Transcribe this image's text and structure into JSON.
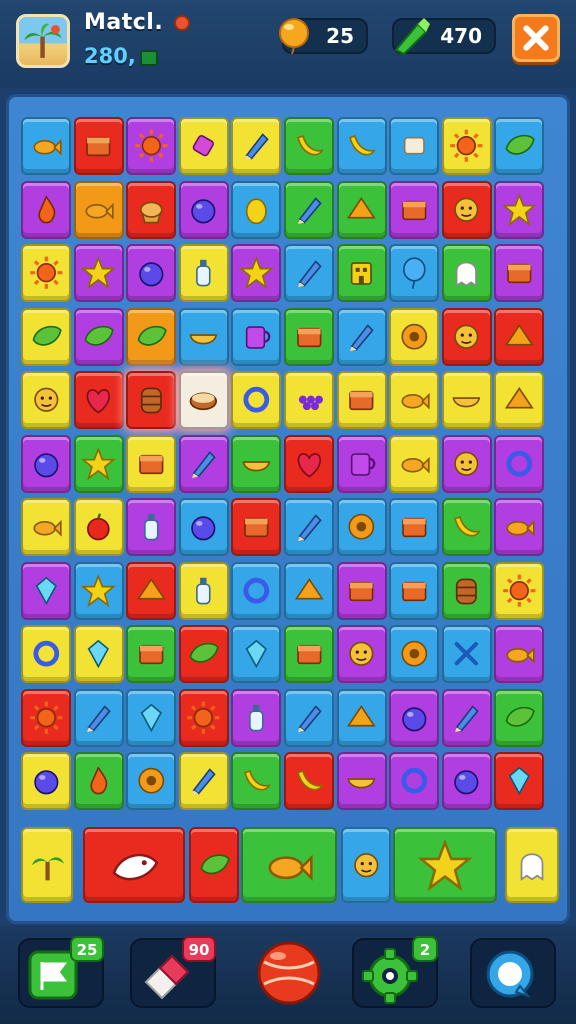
{
  "header": {
    "title": "Matcl.",
    "subscore": "280,",
    "coins": "25",
    "gems": "470"
  },
  "colors": {
    "y": "#f2e233",
    "r": "#e82a1f",
    "g": "#3cc23a",
    "b": "#35a6e8",
    "p": "#b13ee0",
    "o": "#f29a18",
    "w": "#f4eee0"
  },
  "board": {
    "rows": [
      [
        "b",
        "r",
        "p",
        "y",
        "y",
        "g",
        "b",
        "b",
        "y",
        "b"
      ],
      [
        "p",
        "o",
        "r",
        "p",
        "b",
        "g",
        "g",
        "p",
        "r",
        "p"
      ],
      [
        "y",
        "p",
        "p",
        "y",
        "p",
        "b",
        "g",
        "b",
        "g",
        "p"
      ],
      [
        "y",
        "p",
        "o",
        "b",
        "b",
        "g",
        "b",
        "y",
        "r",
        "r"
      ],
      [
        "y",
        "r",
        "r",
        "w",
        "y",
        "y",
        "y",
        "y",
        "y",
        "y"
      ],
      [
        "p",
        "g",
        "y",
        "p",
        "g",
        "r",
        "p",
        "y",
        "p",
        "p"
      ],
      [
        "y",
        "y",
        "p",
        "b",
        "r",
        "b",
        "b",
        "b",
        "g",
        "p"
      ],
      [
        "p",
        "b",
        "r",
        "y",
        "b",
        "b",
        "p",
        "b",
        "g",
        "y"
      ],
      [
        "y",
        "y",
        "g",
        "r",
        "b",
        "g",
        "p",
        "b",
        "b",
        "p"
      ],
      [
        "r",
        "b",
        "b",
        "r",
        "p",
        "b",
        "b",
        "p",
        "p",
        "g"
      ],
      [
        "y",
        "g",
        "b",
        "y",
        "g",
        "r",
        "p",
        "p",
        "p",
        "r"
      ]
    ],
    "bottom_row": [
      "y",
      "r",
      "r",
      "g",
      "b",
      "g",
      "y"
    ],
    "icons": [
      [
        "fish",
        "box",
        "sun",
        "candy",
        "pencil",
        "banana",
        "banana",
        "scroll",
        "sun",
        "leaf"
      ],
      [
        "drop",
        "fish",
        "cupcake",
        "ball",
        "lemon",
        "pencil",
        "shell",
        "box",
        "face",
        "star"
      ],
      [
        "sun",
        "star",
        "ball",
        "bottle",
        "star",
        "pencil",
        "house",
        "balloon",
        "ghost",
        "box"
      ],
      [
        "leaf",
        "leaf",
        "leaf",
        "bowl",
        "cup",
        "box",
        "pencil",
        "donut",
        "face",
        "shell"
      ],
      [
        "face",
        "heart",
        "barrel",
        "pie",
        "ring",
        "grapes",
        "box",
        "fish",
        "bowl",
        "shell"
      ],
      [
        "ball",
        "star",
        "box",
        "pencil",
        "bowl",
        "heart",
        "cup",
        "fish",
        "face",
        "ring"
      ],
      [
        "fish",
        "apple",
        "bottle",
        "ball",
        "box",
        "pencil",
        "donut",
        "box",
        "banana",
        "fish"
      ],
      [
        "gem",
        "star",
        "shell",
        "bottle",
        "ring",
        "shell",
        "box",
        "box",
        "barrel",
        "sun"
      ],
      [
        "ring",
        "gem",
        "box",
        "leaf",
        "gem",
        "box",
        "face",
        "donut",
        "cross",
        "fish"
      ],
      [
        "sun",
        "pencil",
        "gem",
        "sun",
        "bottle",
        "pencil",
        "shell",
        "ball",
        "pencil",
        "leaf"
      ],
      [
        "ball",
        "drop",
        "donut",
        "pencil",
        "banana",
        "banana",
        "bowl",
        "ring",
        "ball",
        "gem"
      ]
    ],
    "bottom_icons": [
      "palm",
      "bird",
      "leaf",
      "fish",
      "face",
      "star",
      "ghost"
    ],
    "highlighted": [
      [
        4,
        2
      ],
      [
        4,
        3
      ]
    ]
  },
  "toolbar": {
    "items": [
      {
        "name": "flag-icon",
        "badge": "25",
        "color": "#3cc23a"
      },
      {
        "name": "eraser-icon",
        "badge": "90",
        "color": "#e83a5a"
      },
      {
        "name": "ball-icon",
        "badge": "",
        "color": "#e83a1f"
      },
      {
        "name": "gear-icon",
        "badge": "2",
        "color": "#3cc23a"
      },
      {
        "name": "bubble-icon",
        "badge": "",
        "color": "#35a6e8"
      }
    ]
  }
}
